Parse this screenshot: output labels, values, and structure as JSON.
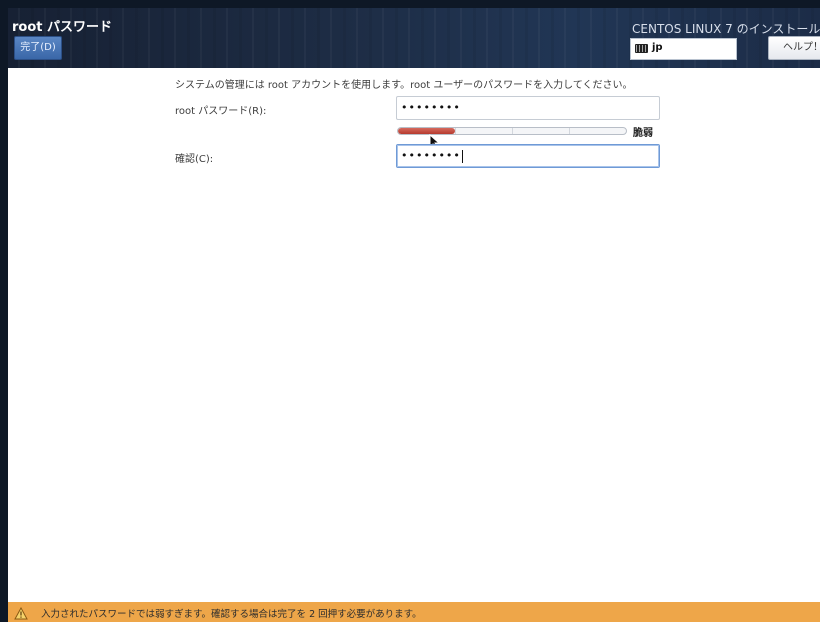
{
  "header": {
    "title": "root パスワード",
    "done_label": "完了(D)",
    "install_title": "CENTOS LINUX 7 のインストール",
    "keyboard_layout": "jp",
    "help_label": "ヘルプ！"
  },
  "form": {
    "instruction": "システムの管理には root アカウントを使用します。root ユーザーのパスワードを入力してください。",
    "password_label": "root パスワード(R):",
    "password_value": "••••••••",
    "confirm_label": "確認(C):",
    "confirm_value": "••••••••",
    "strength_label": "脆弱",
    "strength_level": 0.25,
    "strength_color": "#c0453a"
  },
  "warning": {
    "icon": "warning-icon",
    "text": "入力されたパスワードでは弱すぎます。確認する場合は完了を 2 回押す必要があります。",
    "color": "#eea649"
  },
  "colors": {
    "header_bg": "#1d2c44",
    "done_button": "#4a76b6"
  }
}
